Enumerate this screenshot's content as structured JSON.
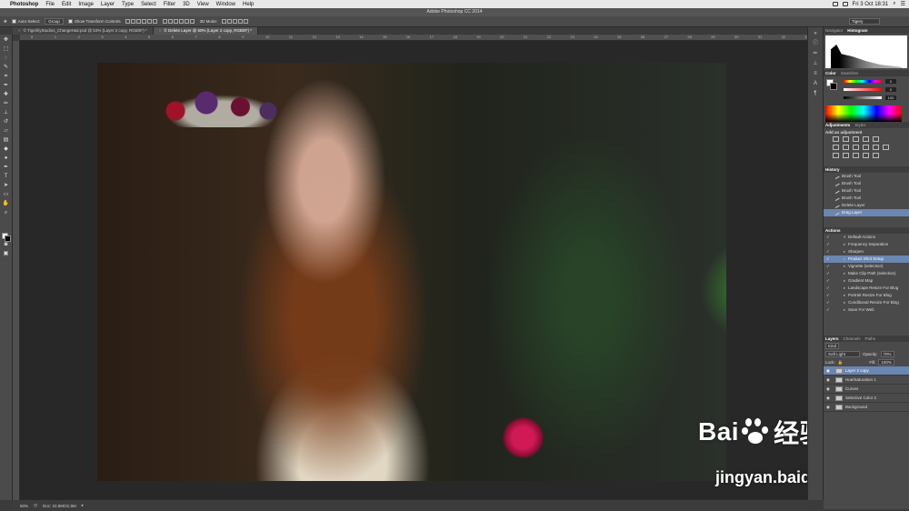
{
  "menubar": {
    "apple": "",
    "app_name": "Photoshop",
    "items": [
      "File",
      "Edit",
      "Image",
      "Layer",
      "Type",
      "Select",
      "Filter",
      "3D",
      "View",
      "Window",
      "Help"
    ],
    "clock": "Fri 3 Oct  18:31"
  },
  "window_title": "Adobe Photoshop CC 2014",
  "options": {
    "auto_select_label": "Auto-Select:",
    "auto_select_value": "Group",
    "transform_label": "Show Transform Controls",
    "mode_3d_label": "3D Mode:",
    "workspace": "Tigery"
  },
  "doc_tabs": [
    "© TigerlilyStudios_ChangeHair.psd @ 53% (Layer 2 copy, RGB/8*) *",
    "© Delete Layer @ 50% (Layer 2 copy, RGB/8*) *"
  ],
  "ruler_h": [
    "0",
    "1",
    "2",
    "3",
    "4",
    "5",
    "6",
    "7",
    "8",
    "9",
    "10",
    "11",
    "12",
    "13",
    "14",
    "15",
    "16",
    "17",
    "18",
    "19",
    "20",
    "21",
    "22",
    "23",
    "24",
    "25",
    "26",
    "27",
    "28",
    "29",
    "30",
    "31",
    "32",
    "33"
  ],
  "status": {
    "zoom": "50%",
    "doc": "Doc: 23.9M/31.9M"
  },
  "panels": {
    "navigator_tab": "Navigator",
    "histogram_tab": "Histogram",
    "color_tab": "Color",
    "swatches_tab": "Swatches",
    "color_values": [
      "0",
      "0",
      "100"
    ],
    "adjustments_tab": "Adjustments",
    "styles_tab": "Styles",
    "add_adjustment": "Add an adjustment",
    "history_tab": "History",
    "history_items": [
      "Brush Tool",
      "Brush Tool",
      "Brush Tool",
      "Brush Tool",
      "Delete Layer",
      "Drag Layer"
    ],
    "actions_tab": "Actions",
    "actions_items": [
      "Default Actions",
      "Frequency Separation",
      "Sharpen",
      "Product Shot Setup",
      "Vignette (selection)",
      "Make Clip Path (selection)",
      "Gradient Map",
      "Landscape Resize For Blog",
      "Portrait Resize For Blog",
      "Conditional Resize For Blog",
      "Save For Web"
    ],
    "layers_tab": "Layers",
    "channels_tab": "Channels",
    "paths_tab": "Paths",
    "kind_label": "Kind",
    "blend_mode": "Soft Light",
    "opacity_label": "Opacity:",
    "opacity_value": "70%",
    "lock_label": "Lock:",
    "fill_label": "Fill:",
    "fill_value": "100%",
    "layers": [
      "Layer 2 copy",
      "Hue/Saturation 1",
      "Curves",
      "Selective Color 2",
      "Background"
    ]
  },
  "watermark": {
    "logo_text": "Bai",
    "logo_text2": "经验",
    "url": "jingyan.baidu.com"
  }
}
